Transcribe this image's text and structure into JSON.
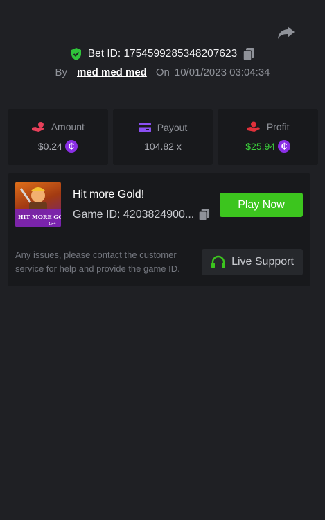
{
  "bet": {
    "label": "Bet ID: 1754599285348207623",
    "by_label": "By",
    "username": "med med med",
    "on_label": "On",
    "datetime": "10/01/2023 03:04:34"
  },
  "stats": {
    "amount": {
      "label": "Amount",
      "value": "$0.24",
      "icon": "hand-coin-icon",
      "icon_color": "#e8405a"
    },
    "payout": {
      "label": "Payout",
      "value": "104.82 x",
      "icon": "card-icon",
      "icon_color": "#8b4ff2"
    },
    "profit": {
      "label": "Profit",
      "value": "$25.94",
      "icon": "hand-gift-icon",
      "icon_color": "#e0303a"
    },
    "coin_symbol": "₵"
  },
  "game": {
    "title": "Hit more Gold!",
    "id_text": "Game ID: 4203824900...",
    "play_label": "Play Now",
    "thumb_text": "HIT MORE GOLD!",
    "thumb_badge": "1×4"
  },
  "support": {
    "text": "Any issues, please contact the customer service for help and provide the game ID.",
    "button_label": "Live Support"
  },
  "colors": {
    "background": "#1f2024",
    "card": "#18191c",
    "accent_green": "#3cc51e",
    "profit_green": "#3bd13b",
    "coin_purple": "#8b2fe6"
  }
}
